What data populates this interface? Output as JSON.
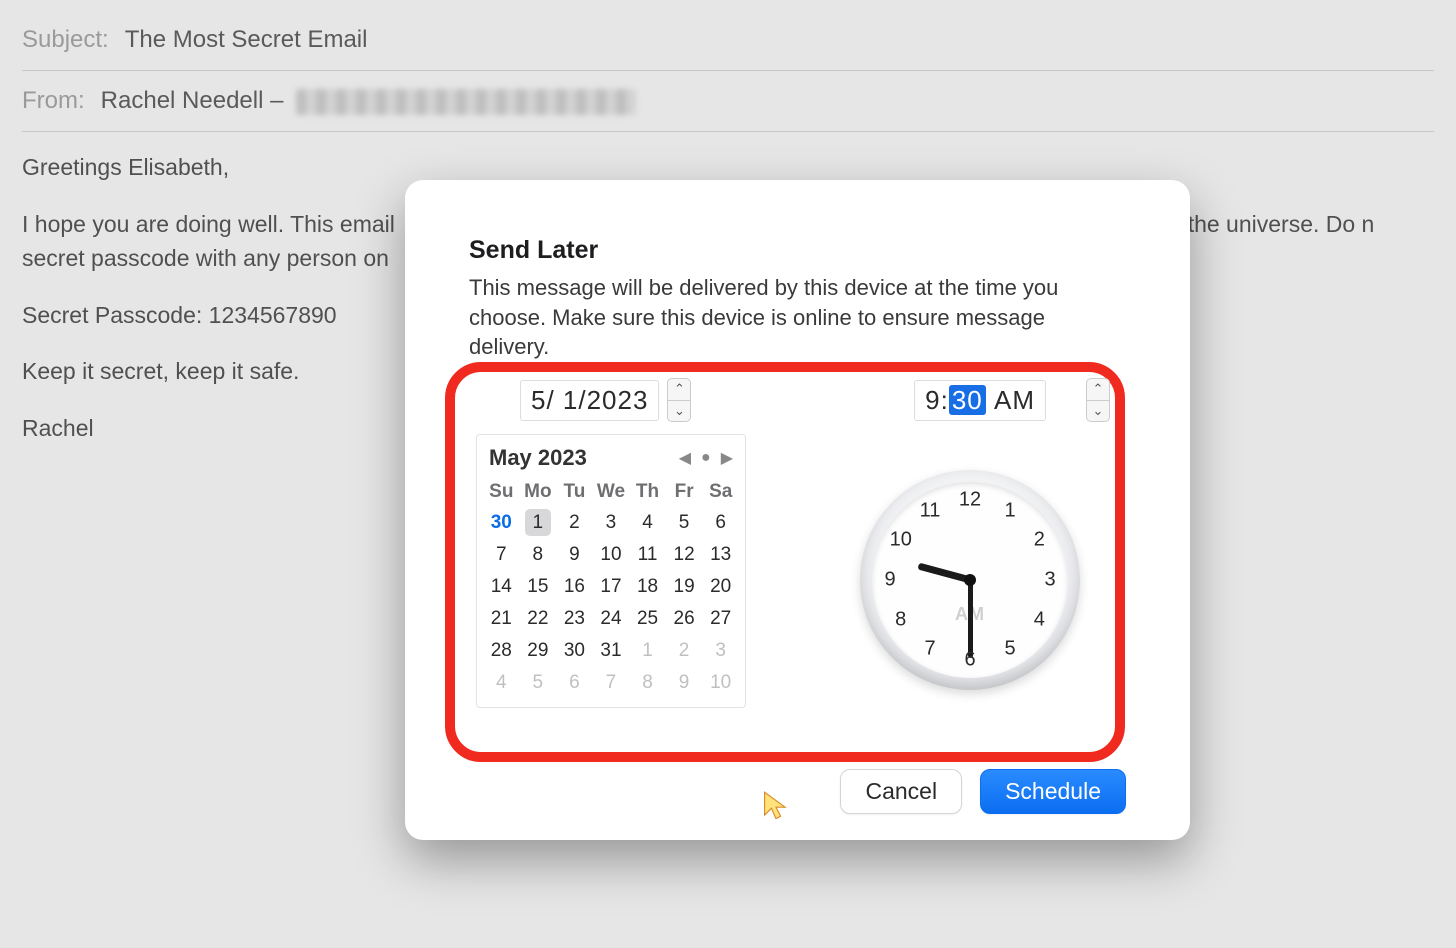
{
  "email": {
    "subject_label": "Subject:",
    "subject_value": "The Most Secret Email",
    "from_label": "From:",
    "from_name": "Rachel Needell –",
    "body": {
      "greeting": "Greetings Elisabeth,",
      "p1_left": "I hope you are doing well. This email",
      "p1_right": "the universe. Do n",
      "p2": "secret passcode with any person on",
      "passcode_line": "Secret Passcode: 1234567890",
      "tagline": "Keep it secret, keep it safe.",
      "signoff": "Rachel"
    }
  },
  "dialog": {
    "title": "Send Later",
    "description": "This message will be delivered by this device at the time you choose. Make sure this device is online to ensure message delivery.",
    "date_value": "5/  1/2023",
    "time_hour": "9",
    "time_min": "30",
    "time_ampm": "AM",
    "buttons": {
      "cancel": "Cancel",
      "schedule": "Schedule"
    }
  },
  "calendar": {
    "title": "May 2023",
    "weekdays": [
      "Su",
      "Mo",
      "Tu",
      "We",
      "Th",
      "Fr",
      "Sa"
    ],
    "rows": [
      [
        {
          "d": "30",
          "dim": false,
          "today": true
        },
        {
          "d": "1",
          "sel": true
        },
        {
          "d": "2"
        },
        {
          "d": "3"
        },
        {
          "d": "4"
        },
        {
          "d": "5"
        },
        {
          "d": "6"
        }
      ],
      [
        {
          "d": "7"
        },
        {
          "d": "8"
        },
        {
          "d": "9"
        },
        {
          "d": "10"
        },
        {
          "d": "11"
        },
        {
          "d": "12"
        },
        {
          "d": "13"
        }
      ],
      [
        {
          "d": "14"
        },
        {
          "d": "15"
        },
        {
          "d": "16"
        },
        {
          "d": "17"
        },
        {
          "d": "18"
        },
        {
          "d": "19"
        },
        {
          "d": "20"
        }
      ],
      [
        {
          "d": "21"
        },
        {
          "d": "22"
        },
        {
          "d": "23"
        },
        {
          "d": "24"
        },
        {
          "d": "25"
        },
        {
          "d": "26"
        },
        {
          "d": "27"
        }
      ],
      [
        {
          "d": "28"
        },
        {
          "d": "29"
        },
        {
          "d": "30"
        },
        {
          "d": "31"
        },
        {
          "d": "1",
          "dim": true
        },
        {
          "d": "2",
          "dim": true
        },
        {
          "d": "3",
          "dim": true
        }
      ],
      [
        {
          "d": "4",
          "dim": true
        },
        {
          "d": "5",
          "dim": true
        },
        {
          "d": "6",
          "dim": true
        },
        {
          "d": "7",
          "dim": true
        },
        {
          "d": "8",
          "dim": true
        },
        {
          "d": "9",
          "dim": true
        },
        {
          "d": "10",
          "dim": true
        }
      ]
    ]
  },
  "clock": {
    "numbers": [
      "12",
      "1",
      "2",
      "3",
      "4",
      "5",
      "6",
      "7",
      "8",
      "9",
      "10",
      "11"
    ],
    "ampm": "AM",
    "hour_angle": 285,
    "minute_angle": 180
  }
}
